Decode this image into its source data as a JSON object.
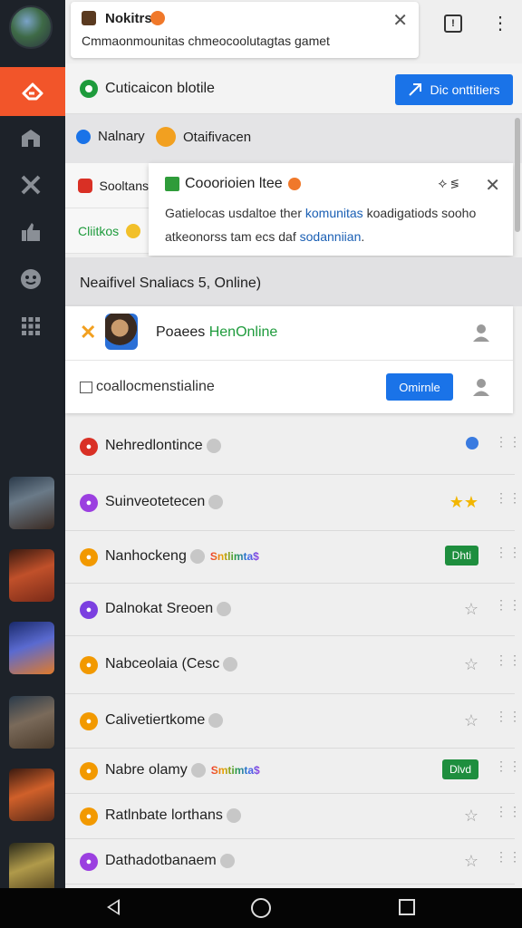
{
  "notification": {
    "title": "Nokitrs",
    "body": "Cmmaonmounitas chmeocoolutagtas gamet"
  },
  "header": {
    "label": "Cuticaicon blotile",
    "button_label": "Dic onttitiers"
  },
  "filters": {
    "chip1": "Nalnary",
    "chip2": "Otaifivacen",
    "side_row1": "Sooltans",
    "side_row2": "Cliitkos"
  },
  "popup": {
    "title": "Cooorioien ltee",
    "tools": "⟡ ≶",
    "body_prefix": "Gatielocas usdaltoe ther ",
    "body_link1": "komunitas",
    "body_mid": " koadigatiods sooho atkeonorss tam ecs daf ",
    "body_link2": "sodanniian",
    "body_suffix": "."
  },
  "section": {
    "label": "Neaifivel Snaliacs 5, Online)"
  },
  "online_card": {
    "line1_prefix": "Poaees ",
    "line1_green": "HenOnline",
    "line2": "coallocmenstialine",
    "button_label": "Omirnle"
  },
  "list": [
    {
      "name": "Nehredlontince",
      "color": "#d93025",
      "right": "pin"
    },
    {
      "name": "Suinveotetecen",
      "color": "#9b3fe0",
      "right": "stars"
    },
    {
      "name": "Nanhockeng",
      "color": "#f29900",
      "extra": "Sntlimta$",
      "right": "pill",
      "pill": "Dhti"
    },
    {
      "name": "Dalnokat Sreoen",
      "color": "#7b3fe0",
      "right": "star"
    },
    {
      "name": "Nabceolaia (Cesc",
      "color": "#f29900",
      "right": "star"
    },
    {
      "name": "Calivetiertkome",
      "color": "#f29900",
      "right": "star"
    },
    {
      "name": "Nabre olamy",
      "color": "#f29900",
      "extra": "Smtimta$",
      "right": "pill",
      "pill": "Dlvd"
    },
    {
      "name": "Ratlnbate lorthans",
      "color": "#f29900",
      "right": "star"
    },
    {
      "name": "Dathadotbanaem",
      "color": "#9b3fe0",
      "right": "star"
    }
  ],
  "colors": {
    "accent_orange": "#f2552a",
    "primary_blue": "#1a73e8",
    "online_green": "#1e9b3c",
    "rail_bg": "#1d2229"
  }
}
